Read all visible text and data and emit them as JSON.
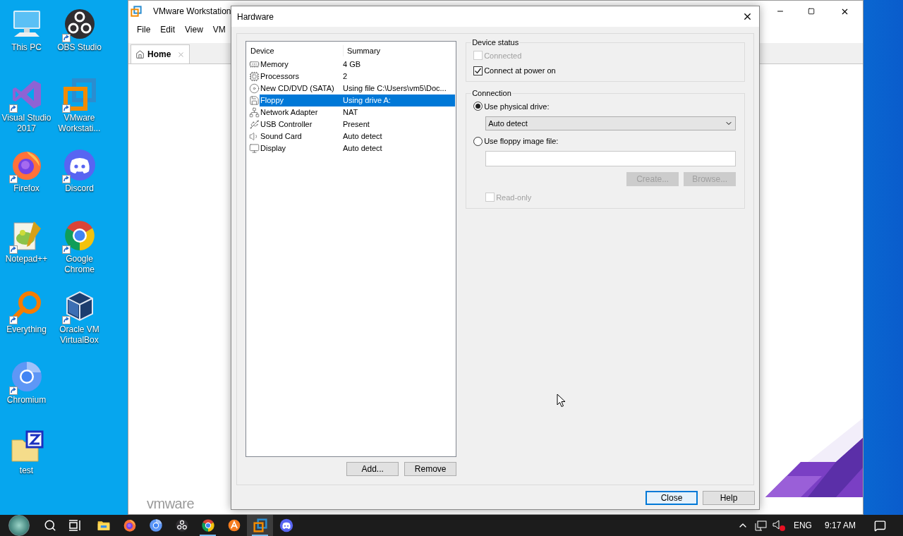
{
  "desktop": {
    "icons": [
      {
        "label": "This PC",
        "shortcut": false
      },
      {
        "label": "Visual Studio 2017",
        "shortcut": true
      },
      {
        "label": "Firefox",
        "shortcut": true
      },
      {
        "label": "Notepad++",
        "shortcut": true
      },
      {
        "label": "Everything",
        "shortcut": true
      },
      {
        "label": "Chromium",
        "shortcut": true
      },
      {
        "label": "test",
        "shortcut": false
      },
      {
        "label": "OBS Studio",
        "shortcut": true
      },
      {
        "label": "VMware Workstati...",
        "shortcut": true
      },
      {
        "label": "Discord",
        "shortcut": true
      },
      {
        "label": "Google Chrome",
        "shortcut": true
      },
      {
        "label": "Oracle VM VirtualBox",
        "shortcut": true
      }
    ]
  },
  "vmware_window": {
    "title": "VMware Workstation",
    "menu": [
      "File",
      "Edit",
      "View",
      "VM"
    ],
    "tabs": [
      {
        "label": "Home",
        "selected": true
      }
    ],
    "logo": "vmware"
  },
  "dialog": {
    "title": "Hardware",
    "columns": [
      "Device",
      "Summary"
    ],
    "devices": [
      {
        "name": "Memory",
        "summary": "4 GB",
        "selected": false
      },
      {
        "name": "Processors",
        "summary": "2",
        "selected": false
      },
      {
        "name": "New CD/DVD (SATA)",
        "summary": "Using file C:\\Users\\vm5\\Doc...",
        "selected": false
      },
      {
        "name": "Floppy",
        "summary": "Using drive A:",
        "selected": true
      },
      {
        "name": "Network Adapter",
        "summary": "NAT",
        "selected": false
      },
      {
        "name": "USB Controller",
        "summary": "Present",
        "selected": false
      },
      {
        "name": "Sound Card",
        "summary": "Auto detect",
        "selected": false
      },
      {
        "name": "Display",
        "summary": "Auto detect",
        "selected": false
      }
    ],
    "list_buttons": [
      "Add...",
      "Remove"
    ],
    "device_status": {
      "title": "Device status",
      "options": [
        {
          "label": "Connected",
          "checked": false,
          "disabled": true
        },
        {
          "label": "Connect at power on",
          "checked": true,
          "disabled": false
        }
      ]
    },
    "connection": {
      "title": "Connection",
      "physical": {
        "label": "Use physical drive:",
        "selected": true
      },
      "drive": {
        "value": "Auto detect"
      },
      "image": {
        "label": "Use floppy image file:",
        "selected": false
      },
      "file_buttons": [
        {
          "label": "Create...",
          "disabled": true
        },
        {
          "label": "Browse...",
          "disabled": true
        }
      ],
      "read_only": {
        "label": "Read-only",
        "checked": false,
        "disabled": true
      }
    },
    "buttons": [
      {
        "label": "Close",
        "focused": true
      },
      {
        "label": "Help",
        "focused": false
      }
    ]
  },
  "taskbar": {
    "apps": [
      {
        "running": false,
        "selected": false
      },
      {
        "running": false,
        "selected": false
      },
      {
        "running": false,
        "selected": false
      },
      {
        "running": false,
        "selected": false
      },
      {
        "running": true,
        "selected": false
      },
      {
        "running": false,
        "selected": false
      },
      {
        "running": true,
        "selected": true
      },
      {
        "running": false,
        "selected": false
      }
    ],
    "language": "ENG",
    "time": "9:17 AM"
  }
}
